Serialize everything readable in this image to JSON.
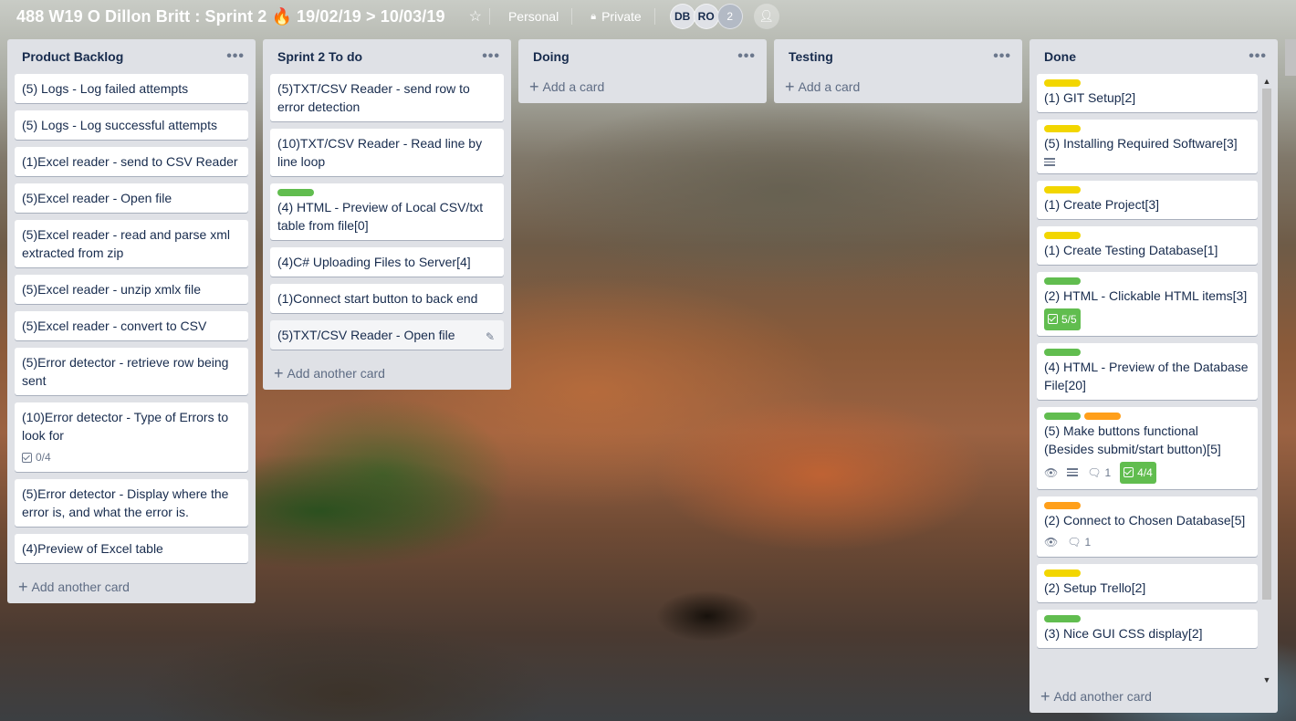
{
  "header": {
    "title": "488 W19 O Dillon Britt : Sprint 2 🔥 19/02/19 > 10/03/19",
    "team": "Personal",
    "visibility": "Private",
    "avatars": [
      "DB",
      "RO"
    ],
    "member_count": "2"
  },
  "colors": {
    "green": "#61bd4f",
    "yellow": "#f2d600",
    "orange": "#ff9f1a"
  },
  "lists": {
    "backlog": {
      "title": "Product Backlog",
      "add_label": "Add another card",
      "cards": [
        "(5) Logs - Log failed attempts",
        "(5) Logs - Log successful attempts",
        "(1)Excel reader - send to CSV Reader",
        "(5)Excel reader - Open file",
        "(5)Excel reader - read and parse xml extracted from zip",
        "(5)Excel reader - unzip xmlx file",
        "(5)Excel reader - convert to CSV",
        "(5)Error detector - retrieve row being sent",
        "(10)Error detector - Type of Errors to look for",
        "(5)Error detector - Display where the error is, and what the error is.",
        "(4)Preview of Excel table"
      ],
      "checklist_8": "0/4"
    },
    "todo": {
      "title": "Sprint 2 To do",
      "add_label": "Add another card",
      "cards": [
        "(5)TXT/CSV Reader - send row to error detection",
        "(10)TXT/CSV Reader - Read line by line loop",
        "(4) HTML - Preview of Local CSV/txt table from file[0]",
        "(4)C# Uploading Files to Server[4]",
        "(1)Connect start button to back end",
        "(5)TXT/CSV Reader - Open file"
      ]
    },
    "doing": {
      "title": "Doing",
      "add_label": "Add a card"
    },
    "testing": {
      "title": "Testing",
      "add_label": "Add a card"
    },
    "done": {
      "title": "Done",
      "add_label": "Add another card",
      "cards": [
        "(1) GIT Setup[2]",
        "(5) Installing Required Software[3]",
        "(1) Create Project[3]",
        "(1) Create Testing Database[1]",
        "(2) HTML - Clickable HTML items[3]",
        "(4) HTML - Preview of the Database File[20]",
        "(5) Make buttons functional (Besides submit/start button)[5]",
        "(2) Connect to Chosen Database[5]",
        "(2) Setup Trello[2]",
        "(3) Nice GUI CSS display[2]"
      ],
      "checklist_4": "5/5",
      "comments_6": "1",
      "checklist_6": "4/4",
      "comments_7": "1"
    }
  }
}
